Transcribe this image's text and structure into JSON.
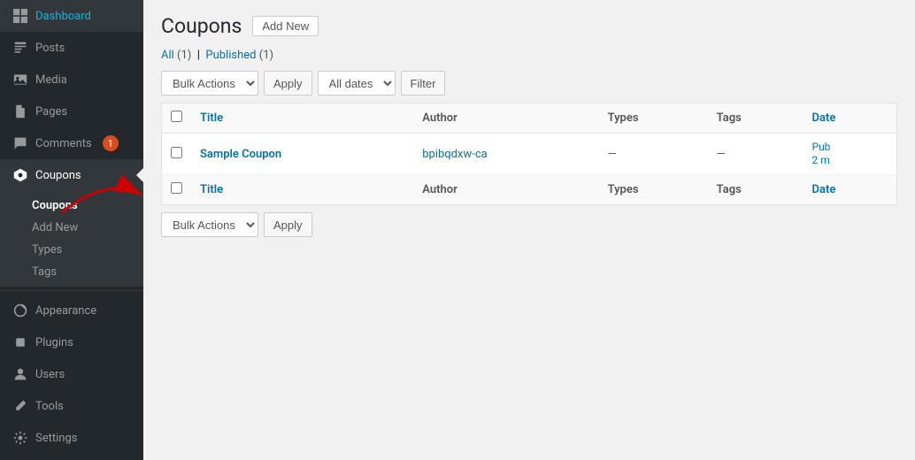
{
  "sidebar": {
    "items": [
      {
        "id": "dashboard",
        "label": "Dashboard",
        "icon": "⊞"
      },
      {
        "id": "posts",
        "label": "Posts",
        "icon": "📄"
      },
      {
        "id": "media",
        "label": "Media",
        "icon": "🖼"
      },
      {
        "id": "pages",
        "label": "Pages",
        "icon": "📋"
      },
      {
        "id": "comments",
        "label": "Comments",
        "icon": "💬",
        "badge": "1"
      },
      {
        "id": "coupons",
        "label": "Coupons",
        "icon": "🏷",
        "active": true
      }
    ],
    "submenu": {
      "coupons_items": [
        {
          "id": "coupons-main",
          "label": "Coupons",
          "active": true
        },
        {
          "id": "add-new",
          "label": "Add New"
        },
        {
          "id": "types",
          "label": "Types"
        },
        {
          "id": "tags",
          "label": "Tags"
        }
      ]
    },
    "bottom_items": [
      {
        "id": "appearance",
        "label": "Appearance",
        "icon": "🎨"
      },
      {
        "id": "plugins",
        "label": "Plugins",
        "icon": "🔌"
      },
      {
        "id": "users",
        "label": "Users",
        "icon": "👤"
      },
      {
        "id": "tools",
        "label": "Tools",
        "icon": "🔧"
      },
      {
        "id": "settings",
        "label": "Settings",
        "icon": "⚙"
      }
    ]
  },
  "page": {
    "title": "Coupons",
    "add_new_label": "Add New",
    "filter_links": {
      "all_label": "All",
      "all_count": "(1)",
      "published_label": "Published",
      "published_count": "(1)"
    },
    "toolbar_top": {
      "bulk_actions_label": "Bulk Actions",
      "apply_label": "Apply",
      "all_dates_label": "All dates",
      "filter_label": "Filter"
    },
    "toolbar_bottom": {
      "bulk_actions_label": "Bulk Actions",
      "apply_label": "Apply"
    },
    "table": {
      "columns": [
        {
          "id": "title",
          "label": "Title"
        },
        {
          "id": "author",
          "label": "Author"
        },
        {
          "id": "types",
          "label": "Types"
        },
        {
          "id": "tags",
          "label": "Tags"
        },
        {
          "id": "date",
          "label": "Date"
        }
      ],
      "rows": [
        {
          "title": "Sample Coupon",
          "title_link": "#",
          "author": "bpibqdxw-ca",
          "author_link": "#",
          "types": "—",
          "tags": "—",
          "date": "Pub",
          "date_sub": "2 m"
        }
      ]
    }
  }
}
